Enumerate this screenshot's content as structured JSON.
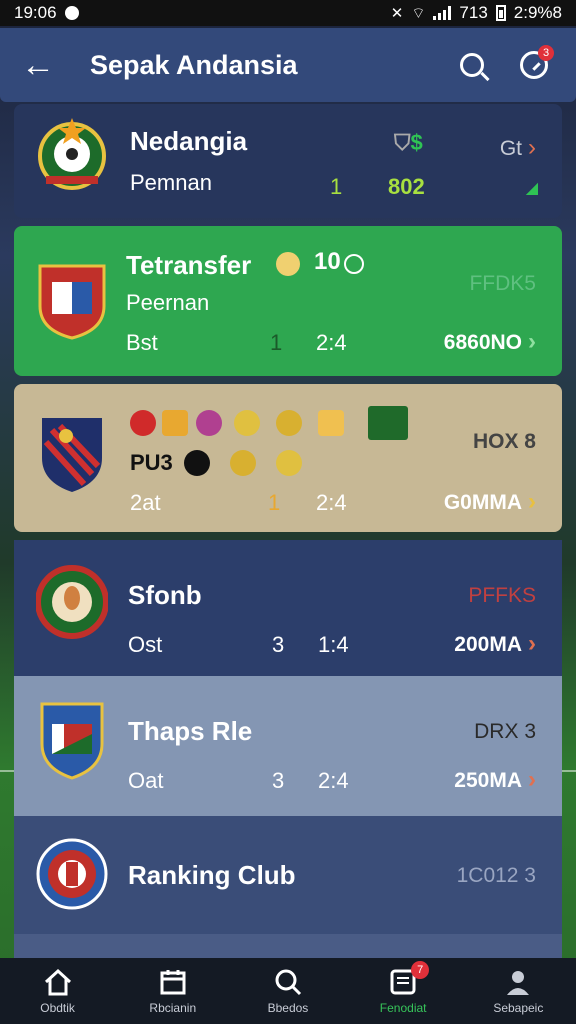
{
  "status_bar": {
    "time": "19:06",
    "right_text": "713",
    "battery_text": "2:9%8"
  },
  "header": {
    "title": "Sepak Andansia"
  },
  "rows": [
    {
      "name": "Nedangia",
      "sub": "Pemnan",
      "c1": "1",
      "c2": "802",
      "badge": "Gt",
      "icon_text": "$",
      "bg": "#27365c"
    },
    {
      "name": "Tetransfer",
      "name_extra": "10",
      "sub": "Peernan",
      "label": "Bst",
      "c1": "1",
      "c2": "2:4",
      "badge": "FFDK5",
      "value": "6860NO",
      "bg": "#2ea750"
    },
    {
      "name": "PU3",
      "label": "2at",
      "c1": "1",
      "c2": "2:4",
      "badge": "HOX 8",
      "value": "G0MMA",
      "bg": "#c7b895"
    },
    {
      "name": "Sfonb",
      "label": "Ost",
      "c1": "3",
      "c2": "1:4",
      "badge": "PFFKS",
      "value": "200MA",
      "bg": "#2c3e6b"
    },
    {
      "name": "Thaps Rle",
      "label": "Oat",
      "c1": "3",
      "c2": "2:4",
      "badge": "DRX 3",
      "value": "250MA",
      "bg": "#8496b3"
    },
    {
      "name": "Ranking Club",
      "badge": "1C012 3",
      "bg": "#3a4d78"
    }
  ],
  "nav": [
    {
      "label": "Obdtik",
      "icon": "home-icon"
    },
    {
      "label": "Rbcianin",
      "icon": "calendar-icon"
    },
    {
      "label": "Bbedos",
      "icon": "search-icon"
    },
    {
      "label": "Fenodiat",
      "icon": "news-icon",
      "badge": "7"
    },
    {
      "label": "Sebapeic",
      "icon": "profile-icon"
    }
  ],
  "colors": {
    "accent_green": "#37c45a",
    "header_bg": "#33497a",
    "alert_red": "#e0303a"
  }
}
